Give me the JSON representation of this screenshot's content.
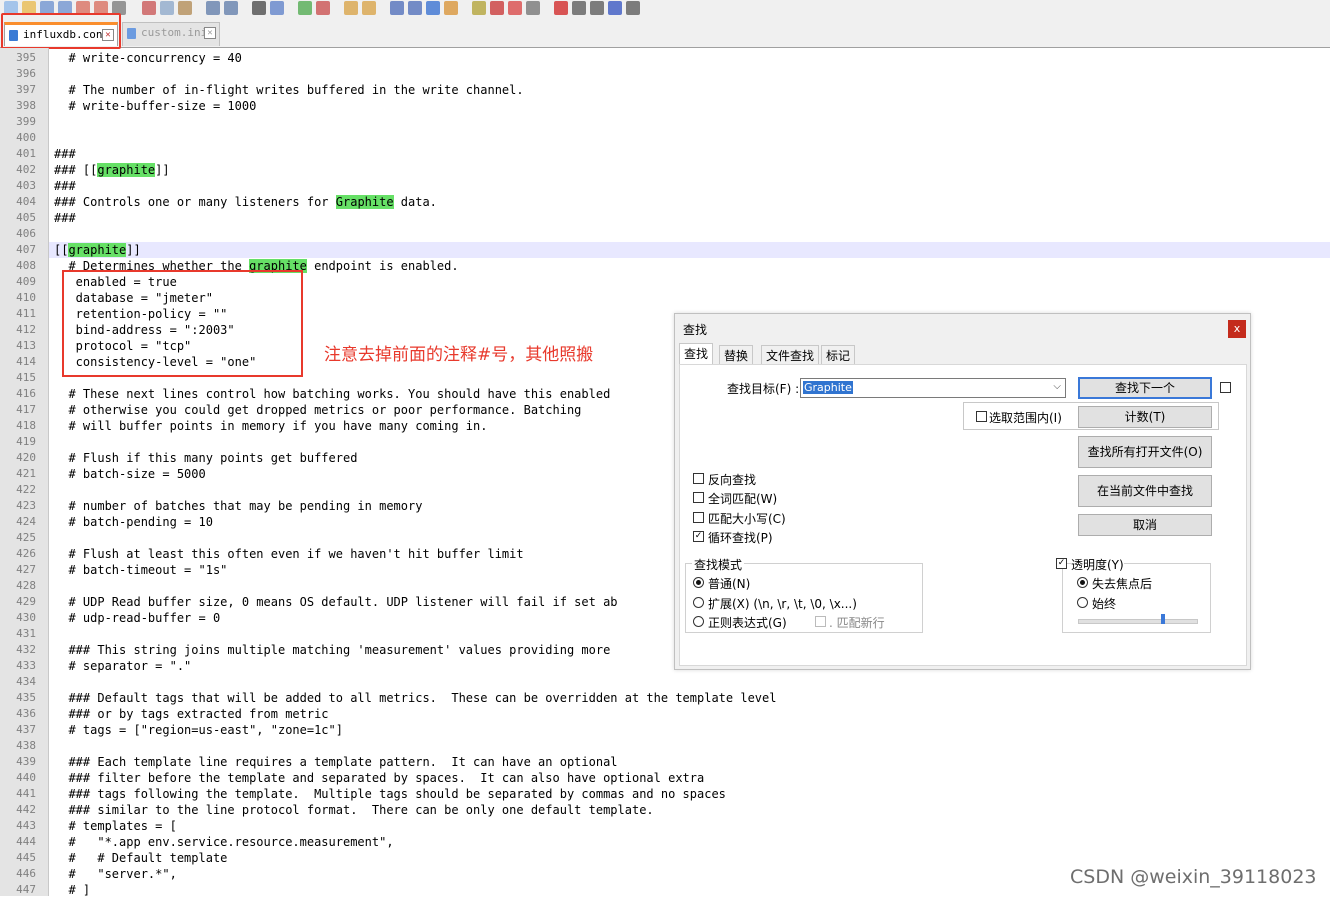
{
  "tabs": [
    {
      "name": "influxdb.conf",
      "active": true
    },
    {
      "name": "custom.ini",
      "active": false
    }
  ],
  "editor": {
    "lines": [
      {
        "n": "395",
        "segs": [
          {
            "t": "  # write-concurrency = 40"
          }
        ]
      },
      {
        "n": "396",
        "segs": [
          {
            "t": ""
          }
        ]
      },
      {
        "n": "397",
        "segs": [
          {
            "t": "  # The number of in-flight writes buffered in the write channel."
          }
        ]
      },
      {
        "n": "398",
        "segs": [
          {
            "t": "  # write-buffer-size = 1000"
          }
        ]
      },
      {
        "n": "399",
        "segs": [
          {
            "t": ""
          }
        ]
      },
      {
        "n": "400",
        "segs": [
          {
            "t": ""
          }
        ]
      },
      {
        "n": "401",
        "segs": [
          {
            "t": "###"
          }
        ]
      },
      {
        "n": "402",
        "segs": [
          {
            "t": "### [["
          },
          {
            "t": "graphite",
            "h": 1
          },
          {
            "t": "]]"
          }
        ]
      },
      {
        "n": "403",
        "segs": [
          {
            "t": "###"
          }
        ]
      },
      {
        "n": "404",
        "segs": [
          {
            "t": "### Controls one or many listeners for "
          },
          {
            "t": "Graphite",
            "h": 1
          },
          {
            "t": " data."
          }
        ]
      },
      {
        "n": "405",
        "segs": [
          {
            "t": "###"
          }
        ]
      },
      {
        "n": "406",
        "segs": [
          {
            "t": ""
          }
        ]
      },
      {
        "n": "407",
        "segs": [
          {
            "t": "[["
          },
          {
            "t": "graphite",
            "h": 1
          },
          {
            "t": "]]"
          }
        ]
      },
      {
        "n": "408",
        "segs": [
          {
            "t": "  # Determines whether the "
          },
          {
            "t": "graphite",
            "h": 1
          },
          {
            "t": " endpoint is enabled."
          }
        ]
      },
      {
        "n": "409",
        "segs": [
          {
            "t": "   enabled = true"
          }
        ]
      },
      {
        "n": "410",
        "segs": [
          {
            "t": "   database = \"jmeter\""
          }
        ]
      },
      {
        "n": "411",
        "segs": [
          {
            "t": "   retention-policy = \"\""
          }
        ]
      },
      {
        "n": "412",
        "segs": [
          {
            "t": "   bind-address = \":2003\""
          }
        ]
      },
      {
        "n": "413",
        "segs": [
          {
            "t": "   protocol = \"tcp\""
          }
        ]
      },
      {
        "n": "414",
        "segs": [
          {
            "t": "   consistency-level = \"one\""
          }
        ]
      },
      {
        "n": "415",
        "segs": [
          {
            "t": ""
          }
        ]
      },
      {
        "n": "416",
        "segs": [
          {
            "t": "  # These next lines control how batching works. You should have this enabled"
          }
        ]
      },
      {
        "n": "417",
        "segs": [
          {
            "t": "  # otherwise you could get dropped metrics or poor performance. Batching"
          }
        ]
      },
      {
        "n": "418",
        "segs": [
          {
            "t": "  # will buffer points in memory if you have many coming in."
          }
        ]
      },
      {
        "n": "419",
        "segs": [
          {
            "t": ""
          }
        ]
      },
      {
        "n": "420",
        "segs": [
          {
            "t": "  # Flush if this many points get buffered"
          }
        ]
      },
      {
        "n": "421",
        "segs": [
          {
            "t": "  # batch-size = 5000"
          }
        ]
      },
      {
        "n": "422",
        "segs": [
          {
            "t": ""
          }
        ]
      },
      {
        "n": "423",
        "segs": [
          {
            "t": "  # number of batches that may be pending in memory"
          }
        ]
      },
      {
        "n": "424",
        "segs": [
          {
            "t": "  # batch-pending = 10"
          }
        ]
      },
      {
        "n": "425",
        "segs": [
          {
            "t": ""
          }
        ]
      },
      {
        "n": "426",
        "segs": [
          {
            "t": "  # Flush at least this often even if we haven't hit buffer limit"
          }
        ]
      },
      {
        "n": "427",
        "segs": [
          {
            "t": "  # batch-timeout = \"1s\""
          }
        ]
      },
      {
        "n": "428",
        "segs": [
          {
            "t": ""
          }
        ]
      },
      {
        "n": "429",
        "segs": [
          {
            "t": "  # UDP Read buffer size, 0 means OS default. UDP listener will fail if set ab"
          }
        ]
      },
      {
        "n": "430",
        "segs": [
          {
            "t": "  # udp-read-buffer = 0"
          }
        ]
      },
      {
        "n": "431",
        "segs": [
          {
            "t": ""
          }
        ]
      },
      {
        "n": "432",
        "segs": [
          {
            "t": "  ### This string joins multiple matching 'measurement' values providing more"
          }
        ]
      },
      {
        "n": "433",
        "segs": [
          {
            "t": "  # separator = \".\""
          }
        ]
      },
      {
        "n": "434",
        "segs": [
          {
            "t": ""
          }
        ]
      },
      {
        "n": "435",
        "segs": [
          {
            "t": "  ### Default tags that will be added to all metrics.  These can be overridden at the template level"
          }
        ]
      },
      {
        "n": "436",
        "segs": [
          {
            "t": "  ### or by tags extracted from metric"
          }
        ]
      },
      {
        "n": "437",
        "segs": [
          {
            "t": "  # tags = [\"region=us-east\", \"zone=1c\"]"
          }
        ]
      },
      {
        "n": "438",
        "segs": [
          {
            "t": ""
          }
        ]
      },
      {
        "n": "439",
        "segs": [
          {
            "t": "  ### Each template line requires a template pattern.  It can have an optional"
          }
        ]
      },
      {
        "n": "440",
        "segs": [
          {
            "t": "  ### filter before the template and separated by spaces.  It can also have optional extra"
          }
        ]
      },
      {
        "n": "441",
        "segs": [
          {
            "t": "  ### tags following the template.  Multiple tags should be separated by commas and no spaces"
          }
        ]
      },
      {
        "n": "442",
        "segs": [
          {
            "t": "  ### similar to the line protocol format.  There can be only one default template."
          }
        ]
      },
      {
        "n": "443",
        "segs": [
          {
            "t": "  # templates = ["
          }
        ]
      },
      {
        "n": "444",
        "segs": [
          {
            "t": "  #   \"*.app env.service.resource.measurement\","
          }
        ]
      },
      {
        "n": "445",
        "segs": [
          {
            "t": "  #   # Default template"
          }
        ]
      },
      {
        "n": "446",
        "segs": [
          {
            "t": "  #   \"server.*\","
          }
        ]
      },
      {
        "n": "447",
        "segs": [
          {
            "t": "  # ]"
          }
        ]
      }
    ],
    "current_line": "407"
  },
  "annotation": "注意去掉前面的注释#号，其他照搬",
  "find_dialog": {
    "title": "查找",
    "close": "x",
    "tabs": [
      "查找",
      "替换",
      "文件查找",
      "标记"
    ],
    "search_label": "查找目标(F) :",
    "search_value": "Graphite",
    "in_selection": "选取范围内(I)",
    "buttons": {
      "find_next": "查找下一个",
      "count": "计数(T)",
      "find_all_open": "查找所有打开文件(O)",
      "find_in_current": "在当前文件中查找",
      "cancel": "取消"
    },
    "options": [
      {
        "label": "反向查找",
        "checked": false
      },
      {
        "label": "全词匹配(W)",
        "checked": false
      },
      {
        "label": "匹配大小写(C)",
        "checked": false
      },
      {
        "label": "循环查找(P)",
        "checked": true
      }
    ],
    "mode": {
      "title": "查找模式",
      "normal": "普通(N)",
      "extended": "扩展(X) (\\n, \\r, \\t, \\0, \\x...)",
      "regex": "正则表达式(G)",
      "match_newline": ". 匹配新行",
      "selected": "normal"
    },
    "transparency": {
      "title": "透明度(Y)",
      "checked": true,
      "on_lose_focus": "失去焦点后",
      "always": "始终",
      "selected": "on_lose_focus",
      "level": 0.72
    }
  },
  "watermark": "CSDN @weixin_39118023",
  "colors": {
    "annotation": "#e8392c",
    "highlight": "#66e066",
    "tab_accent": "#fa8e2d"
  }
}
